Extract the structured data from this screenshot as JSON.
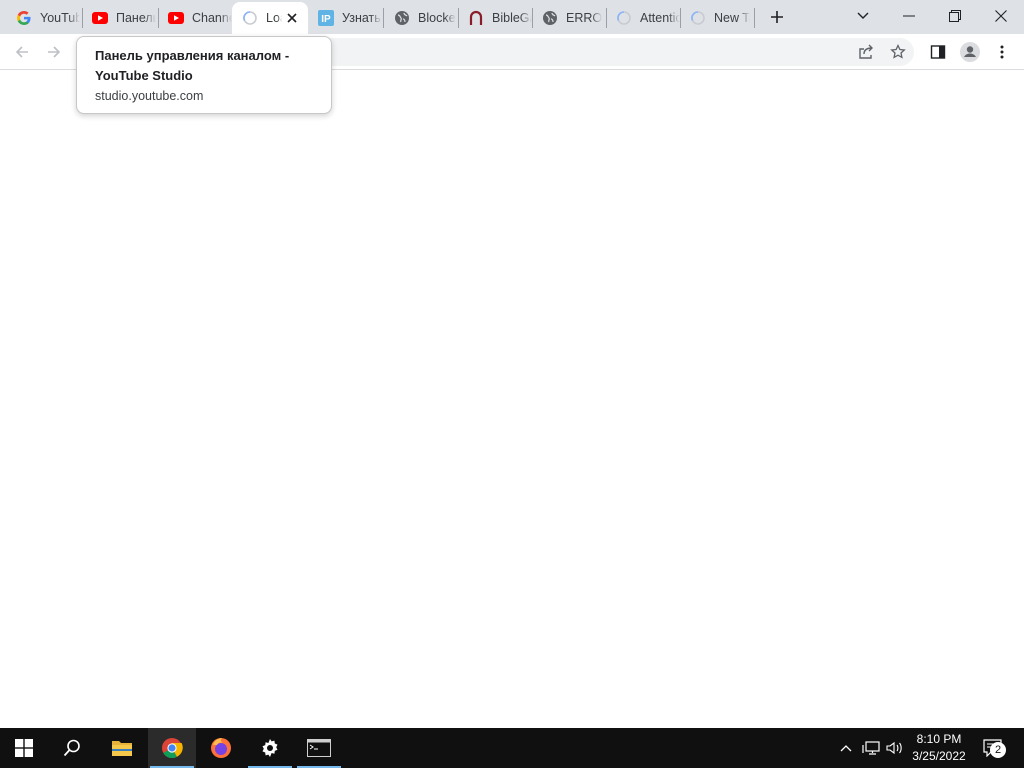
{
  "browser": {
    "tabs": [
      {
        "title": "YouTube",
        "favicon": "google-icon"
      },
      {
        "title": "Панель управления каналом",
        "favicon": "youtube-icon"
      },
      {
        "title": "Channel",
        "favicon": "youtube-icon"
      },
      {
        "title": "Loading",
        "favicon": "loading-spinner-icon",
        "active": true
      },
      {
        "title": "Узнать IP",
        "favicon": "ip-icon"
      },
      {
        "title": "Blocked",
        "favicon": "globe-icon"
      },
      {
        "title": "BibleGateway",
        "favicon": "biblegateway-icon"
      },
      {
        "title": "ERROR",
        "favicon": "globe-icon"
      },
      {
        "title": "Attention",
        "favicon": "loading-spinner-icon"
      },
      {
        "title": "New Tab",
        "favicon": "loading-spinner-icon"
      }
    ],
    "hover_card": {
      "title": "Панель управления каналом - YouTube Studio",
      "url": "studio.youtube.com"
    }
  },
  "taskbar": {
    "apps": [
      "start-icon",
      "search-icon",
      "file-explorer-icon",
      "chrome-icon",
      "firefox-icon",
      "settings-icon",
      "terminal-icon"
    ],
    "clock": {
      "time": "8:10 PM",
      "date": "3/25/2022"
    },
    "notifications_count": "2"
  },
  "colors": {
    "tabstrip": "#dee1e6",
    "taskbar": "#101010",
    "youtube": "#ff0000",
    "accent": "#76b9ed"
  }
}
